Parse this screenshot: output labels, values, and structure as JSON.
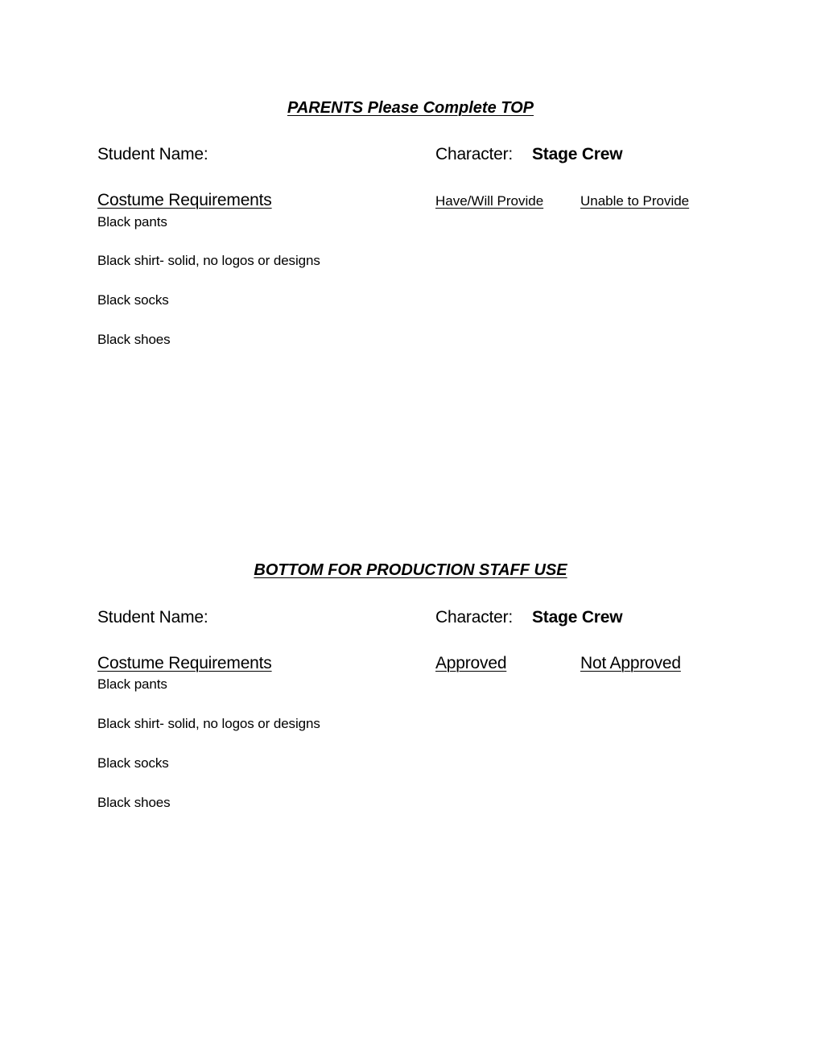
{
  "top_section": {
    "title": "PARENTS Please Complete TOP",
    "student_name_label": "Student Name:",
    "character_label": "Character:",
    "character_value": "Stage Crew",
    "requirements_header": "Costume Requirements",
    "column_1": "Have/Will Provide",
    "column_2": "Unable to Provide",
    "items": [
      "Black pants",
      "Black shirt- solid, no logos or designs",
      "Black socks",
      "Black shoes"
    ]
  },
  "bottom_section": {
    "title": "BOTTOM FOR PRODUCTION STAFF USE",
    "student_name_label": "Student Name:",
    "character_label": "Character:",
    "character_value": "Stage Crew",
    "requirements_header": "Costume Requirements",
    "column_1": "Approved",
    "column_2": "Not Approved",
    "items": [
      "Black pants",
      "Black shirt- solid, no logos or designs",
      "Black socks",
      "Black shoes"
    ]
  }
}
